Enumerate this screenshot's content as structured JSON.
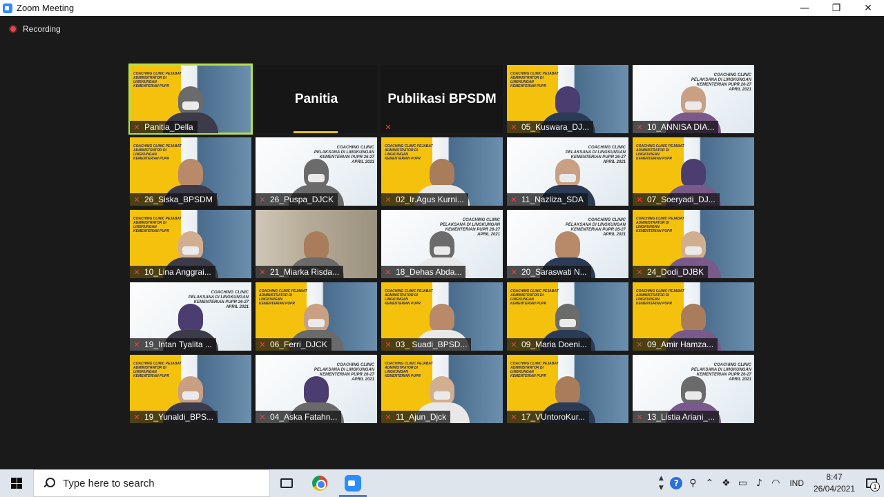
{
  "window": {
    "title": "Zoom Meeting",
    "minimize": "—",
    "restore": "❐",
    "close": "✕"
  },
  "recording": {
    "label": "Recording",
    "color": "#e64545"
  },
  "accent": {
    "active_speaker": "#b7e04a",
    "mic_off": "#e64545"
  },
  "participants": [
    {
      "name": "Panitia_Della",
      "bg": "yellow",
      "video": true,
      "active": true,
      "mic": "mic-off"
    },
    {
      "name": "Panitia",
      "video": false
    },
    {
      "name": "Publikasi BPSDM",
      "video": false
    },
    {
      "name": "05_Kuswara_DJ...",
      "bg": "yellow",
      "video": true
    },
    {
      "name": "10_ANNISA DIA...",
      "bg": "white",
      "video": true
    },
    {
      "name": "26_Siska_BPSDM",
      "bg": "yellow",
      "video": true
    },
    {
      "name": "26_Puspa_DJCK",
      "bg": "white",
      "video": true
    },
    {
      "name": "02_Ir.Agus Kurni...",
      "bg": "yellow",
      "video": true
    },
    {
      "name": "11_Nazliza_SDA",
      "bg": "white",
      "video": true
    },
    {
      "name": "07_Soeryadi_DJ...",
      "bg": "yellow",
      "video": true
    },
    {
      "name": "10_Lina Anggrai...",
      "bg": "yellow",
      "video": true
    },
    {
      "name": "21_Miarka Risda...",
      "bg": "room",
      "video": true
    },
    {
      "name": "18_Dehas Abda...",
      "bg": "white",
      "video": true
    },
    {
      "name": "20_Saraswati N...",
      "bg": "white",
      "video": true
    },
    {
      "name": "24_Dodi_DJBK",
      "bg": "yellow",
      "video": true
    },
    {
      "name": "19_Intan Tyalita ...",
      "bg": "white",
      "video": true
    },
    {
      "name": "06_Ferri_DJCK",
      "bg": "yellow",
      "video": true
    },
    {
      "name": "03_ Suadi_BPSD...",
      "bg": "yellow",
      "video": true
    },
    {
      "name": "09_Maria Doeni...",
      "bg": "yellow",
      "video": true
    },
    {
      "name": "09_Amir Hamza...",
      "bg": "yellow",
      "video": true
    },
    {
      "name": "19_Yunaldi_BPS...",
      "bg": "yellow",
      "video": true
    },
    {
      "name": "04_Aska Fatahn...",
      "bg": "white",
      "video": true
    },
    {
      "name": "11_Ajun_Djck",
      "bg": "yellow",
      "video": true
    },
    {
      "name": "17_VUntoroKur...",
      "bg": "yellow",
      "video": true
    },
    {
      "name": "13_Listia Ariani_...",
      "bg": "white",
      "video": true
    }
  ],
  "banner": {
    "left": "COACHING CLINIC PEJABAT ADMINISTRATOR DI LINGKUNGAN KEMENTERIAN PUPR",
    "right": "COACHING CLINIC PELAKSANA DI LINGKUNGAN KEMENTERIAN PUPR 26-27 APRIL 2021"
  },
  "taskbar": {
    "search_placeholder": "Type here to search",
    "language": "IND",
    "time": "8:47",
    "date": "26/04/2021",
    "notification_count": "1"
  }
}
